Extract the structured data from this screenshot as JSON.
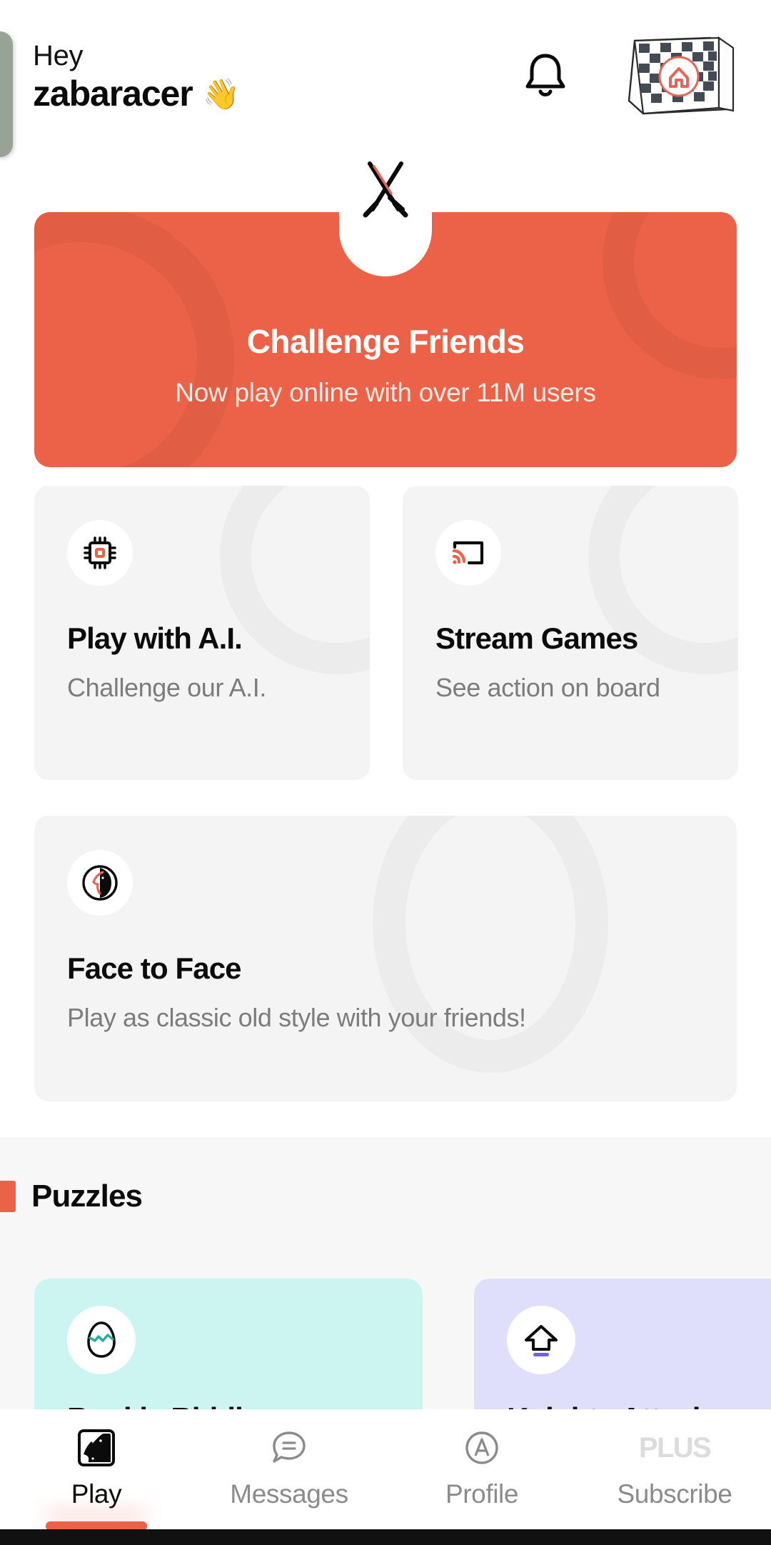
{
  "colors": {
    "accent": "#ec6248",
    "card_gray": "#f4f4f4",
    "section_gray": "#f7f7f7",
    "teal": "#ccf5f2",
    "purple": "#e0dffb",
    "muted_text": "#7c7c7c",
    "dark_text": "#0b0b0b"
  },
  "header": {
    "greeting": "Hey",
    "username": "zabaracer",
    "wave_emoji": "👋",
    "bell_icon": "bell-icon",
    "board_icon": "chessboard-home-icon"
  },
  "banner": {
    "icon": "crossed-swords-icon",
    "title": "Challenge Friends",
    "subtitle": "Now play online with over 11M users"
  },
  "modes": [
    {
      "icon": "cpu-chip-icon",
      "title": "Play with A.I.",
      "subtitle": "Challenge our A.I."
    },
    {
      "icon": "screen-cast-icon",
      "title": "Stream Games",
      "subtitle": "See action on board"
    },
    {
      "icon": "knight-face-icon",
      "title": "Face to Face",
      "subtitle": "Play as classic old style with your friends!"
    }
  ],
  "puzzles": {
    "section_title": "Puzzles",
    "cards": [
      {
        "icon": "cracked-egg-icon",
        "title": "Rookie Riddles"
      },
      {
        "icon": "up-arrow-icon",
        "title": "Knights Attack"
      }
    ]
  },
  "bottom_nav": {
    "items": [
      {
        "label": "Play",
        "icon": "knight-square-icon",
        "active": true
      },
      {
        "label": "Messages",
        "icon": "chat-bubble-icon",
        "active": false
      },
      {
        "label": "Profile",
        "icon": "avatar-circle-a-icon",
        "active": false
      },
      {
        "label": "Subscribe",
        "icon": "plus-wordmark-icon",
        "active": false
      }
    ],
    "subscribe_wordmark": "PLUS"
  }
}
